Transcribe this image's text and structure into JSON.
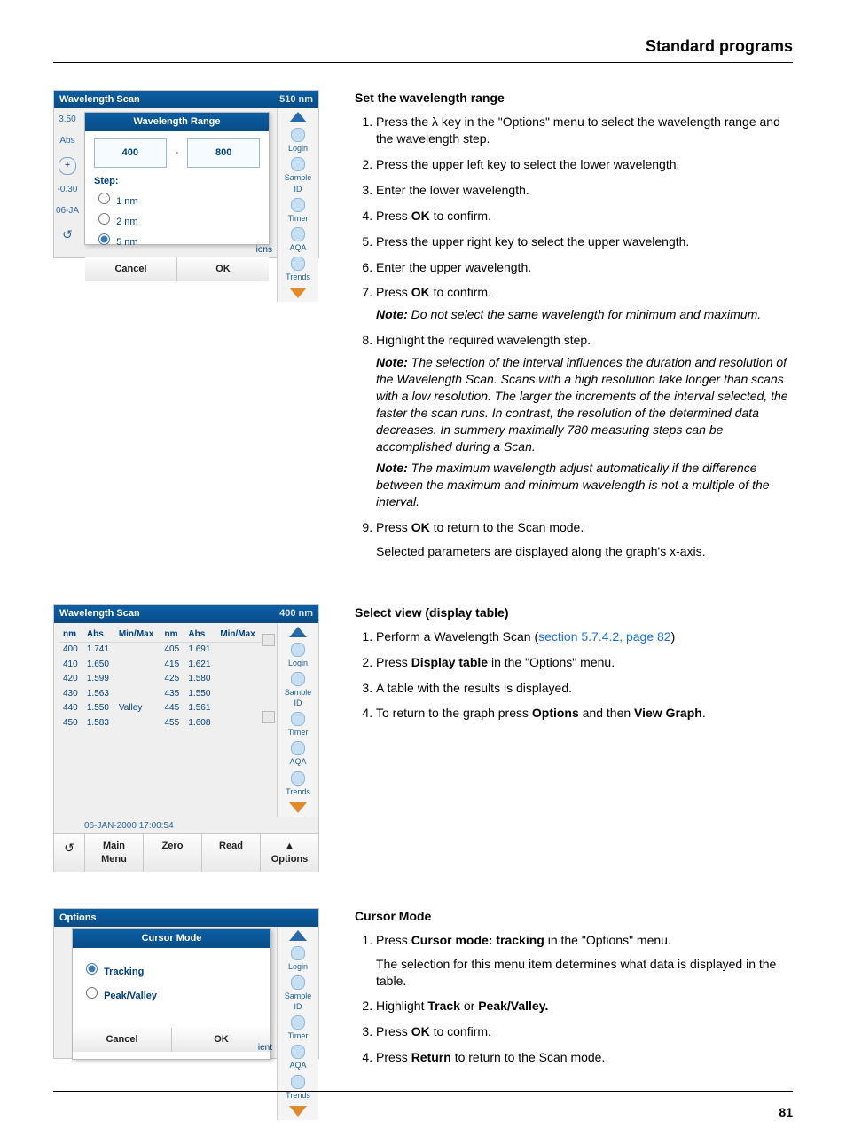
{
  "header": {
    "title": "Standard programs"
  },
  "page_number": "81",
  "screens": {
    "wl_range": {
      "app_title": "Wavelength Scan",
      "top_right": "510 nm",
      "axis": {
        "ymax": "3.50",
        "ymin": "-0.30",
        "yunit": "Abs",
        "datestub": "06-JA"
      },
      "popup": {
        "title": "Wavelength Range",
        "low": "400",
        "high": "800",
        "step_label": "Step:",
        "steps": [
          "1 nm",
          "2 nm",
          "5 nm"
        ],
        "selected_step": "5 nm",
        "cancel": "Cancel",
        "ok": "OK"
      },
      "bottom_caption": "ions"
    },
    "table_view": {
      "app_title": "Wavelength Scan",
      "top_right": "400 nm",
      "columns": [
        "nm",
        "Abs",
        "Min/Max",
        "nm",
        "Abs",
        "Min/Max"
      ],
      "rows": [
        [
          "400",
          "1.741",
          "",
          "405",
          "1.691",
          ""
        ],
        [
          "410",
          "1.650",
          "",
          "415",
          "1.621",
          ""
        ],
        [
          "420",
          "1.599",
          "",
          "425",
          "1.580",
          ""
        ],
        [
          "430",
          "1.563",
          "",
          "435",
          "1.550",
          ""
        ],
        [
          "440",
          "1.550",
          "Valley",
          "445",
          "1.561",
          ""
        ],
        [
          "450",
          "1.583",
          "",
          "455",
          "1.608",
          ""
        ]
      ],
      "timestamp": "06-JAN-2000  17:00:54",
      "buttons": {
        "back": "↺",
        "main": "Main\nMenu",
        "zero": "Zero",
        "read": "Read",
        "options": "Options"
      }
    },
    "cursor_mode": {
      "app_title": "Options",
      "popup_title": "Cursor Mode",
      "opts": [
        "Tracking",
        "Peak/Valley"
      ],
      "selected": "Tracking",
      "cancel": "Cancel",
      "ok": "OK",
      "bottom_caption": "ient"
    },
    "sidebar": {
      "items": [
        "Login",
        "Sample ID",
        "Timer",
        "AQA",
        "Trends"
      ]
    }
  },
  "sections": {
    "set_range": {
      "title": "Set the wavelength range",
      "steps": [
        "Press the λ key in the \"Options\" menu to select the wavelength range and the wavelength step.",
        "Press the upper left key to select the lower wavelength.",
        "Enter the lower wavelength.",
        "Press <b>OK</b> to confirm.",
        "Press the upper right key to select the upper wavelength.",
        "Enter the upper wavelength.",
        "Press <b>OK</b> to confirm."
      ],
      "note_after_7": "Do not select the same wavelength for minimum and maximum.",
      "step8": "Highlight the required wavelength step.",
      "note_after_8a": "The selection of the interval influences the duration and resolution of the Wavelength Scan. Scans with a high resolution take longer than scans with a low resolution. The larger the increments of the interval selected, the faster the scan runs. In contrast, the resolution of the determined data decreases. In summery maximally 780 measuring steps can be accomplished during a Scan.",
      "note_after_8b": "The maximum wavelength adjust automatically if the difference between the maximum and minimum wavelength is not a multiple of the interval.",
      "step9": "Press <b>OK</b> to return to the Scan mode.",
      "after_9": "Selected parameters are displayed along the graph's x-axis."
    },
    "select_view": {
      "title": "Select view (display table)",
      "xref": "section 5.7.4.2, page 82",
      "s1a": "Perform a Wavelength Scan (",
      "s1b": ")",
      "s2": "Press <b>Display table</b> in the \"Options\" menu.",
      "s3": "A table with the results is displayed.",
      "s4": "To return to the graph press <b>Options</b> and then <b>View Graph</b>."
    },
    "cursor_mode": {
      "title": "Cursor Mode",
      "s1": "Press <b>Cursor mode: tracking</b> in the \"Options\" menu.",
      "s1_after": "The selection for this menu item determines what data is displayed in the table.",
      "s2": "Highlight <b>Track</b> or <b>Peak/Valley.</b>",
      "s3": "Press <b>OK</b> to confirm.",
      "s4": "Press <b>Return</b> to return to the Scan mode."
    }
  }
}
